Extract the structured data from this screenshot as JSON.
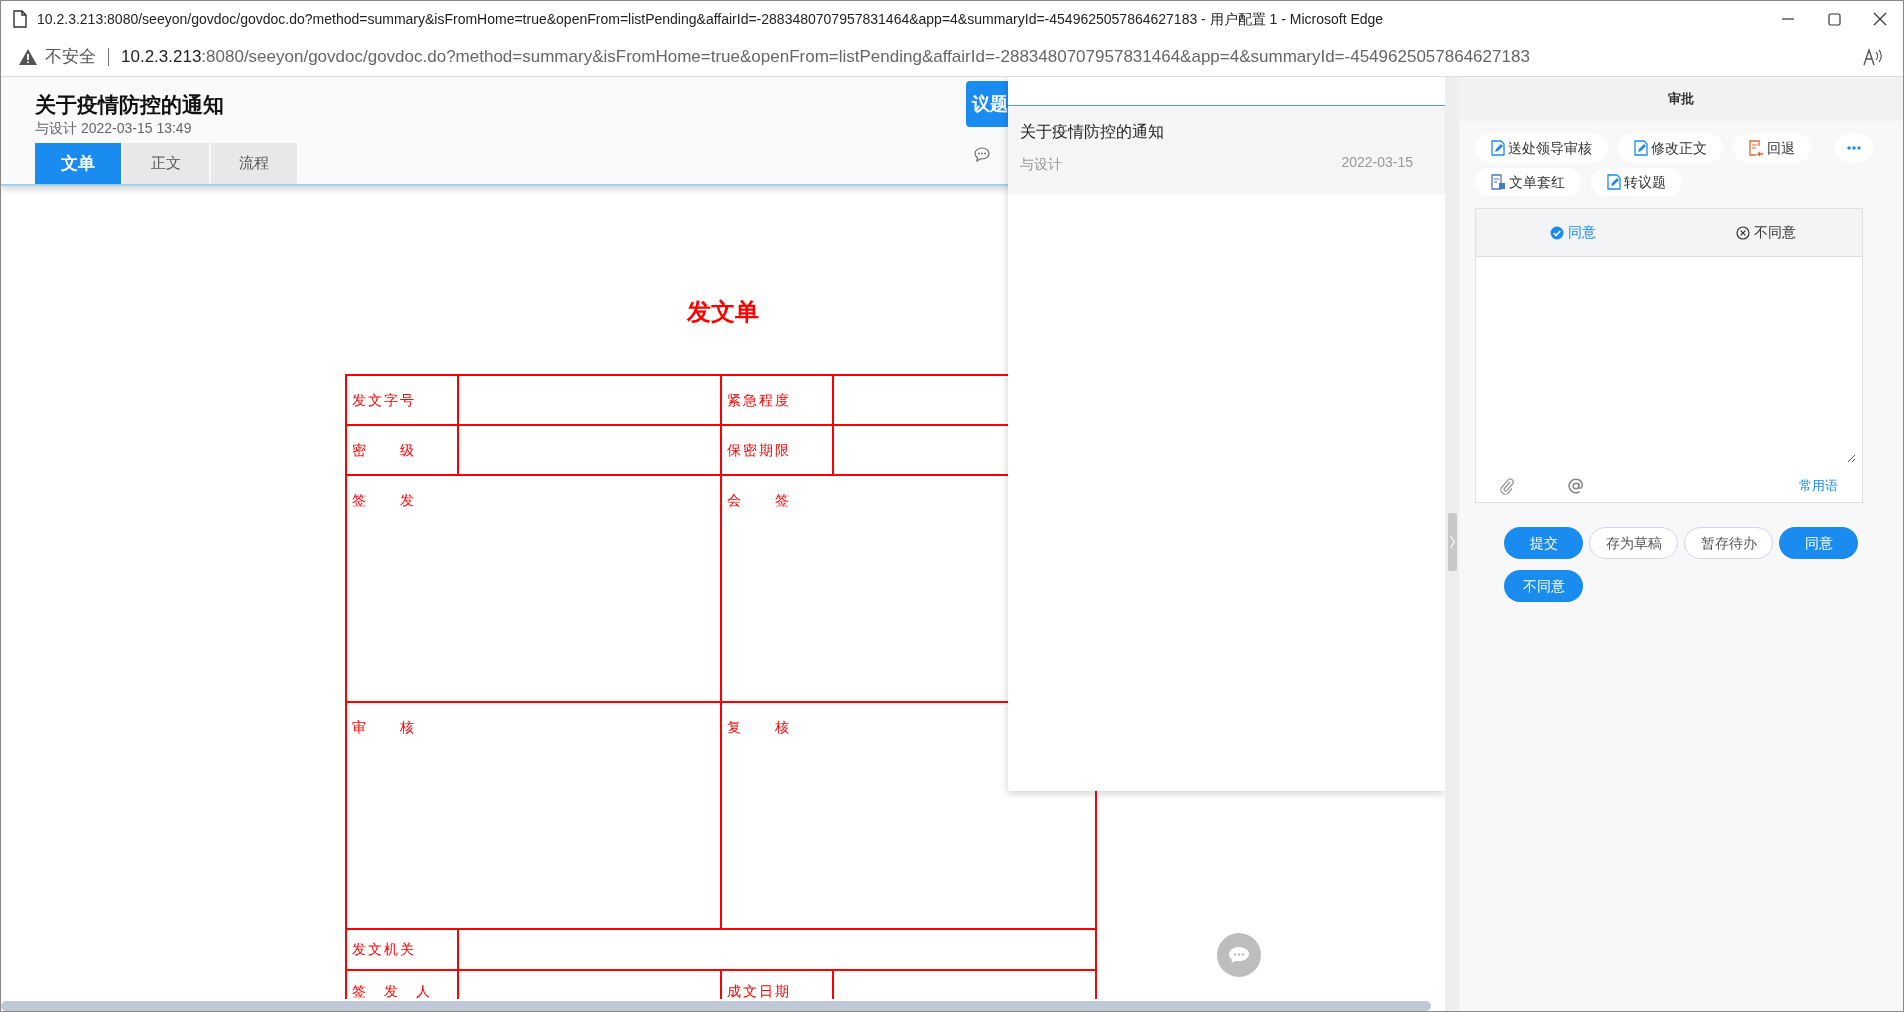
{
  "browser": {
    "title": "10.2.3.213:8080/seeyon/govdoc/govdoc.do?method=summary&isFromHome=true&openFrom=listPending&affairId=-2883480707957831464&app=4&summaryId=-4549625057864627183 - 用户配置 1 - Microsoft Edge",
    "security_label": "不安全",
    "url_host": "10.2.3.213",
    "url_rest": ":8080/seeyon/govdoc/govdoc.do?method=summary&isFromHome=true&openFrom=listPending&affairId=-2883480707957831464&app=4&summaryId=-4549625057864627183"
  },
  "document": {
    "title": "关于疫情防控的通知",
    "meta": "与设计 2022-03-15 13:49",
    "topic_button": "议题",
    "tabs": [
      {
        "label": "文单",
        "selected": true
      },
      {
        "label": "正文",
        "selected": false
      },
      {
        "label": "流程",
        "selected": false
      }
    ]
  },
  "form": {
    "title": "发文单",
    "rows": [
      {
        "kind": "short",
        "cells": [
          {
            "kind": "label",
            "text": "发文字号"
          },
          {
            "kind": "value"
          },
          {
            "kind": "label",
            "text": "紧急程度"
          },
          {
            "kind": "value"
          }
        ]
      },
      {
        "kind": "short",
        "cells": [
          {
            "kind": "label",
            "text": "密　　级"
          },
          {
            "kind": "value"
          },
          {
            "kind": "label",
            "text": "保密期限"
          },
          {
            "kind": "value"
          }
        ]
      },
      {
        "kind": "tall",
        "cells": [
          {
            "kind": "area",
            "text": "签　　发"
          },
          {
            "kind": "area",
            "text": "会　　签"
          }
        ]
      },
      {
        "kind": "tall",
        "cells": [
          {
            "kind": "area",
            "text": "审　　核"
          },
          {
            "kind": "area",
            "text": "复　　核"
          }
        ]
      },
      {
        "kind": "line",
        "cells": [
          {
            "kind": "label",
            "text": "发文机关"
          },
          {
            "kind": "wide"
          }
        ]
      },
      {
        "kind": "cut",
        "cells": [
          {
            "kind": "label",
            "text": "签　发　人"
          },
          {
            "kind": "value"
          },
          {
            "kind": "label",
            "text": "成文日期"
          },
          {
            "kind": "value"
          }
        ]
      }
    ]
  },
  "popup": {
    "title": "关于疫情防控的通知",
    "author": "与设计",
    "date": "2022-03-15"
  },
  "approval": {
    "title": "审批",
    "actions": [
      {
        "label": "送处领导审核",
        "kind": "edit"
      },
      {
        "label": "修改正文",
        "kind": "edit"
      },
      {
        "label": "回退",
        "kind": "return"
      },
      {
        "label": "文单套红",
        "kind": "stamp"
      },
      {
        "label": "转议题",
        "kind": "edit"
      }
    ],
    "opinion_tabs": [
      {
        "label": "同意",
        "kind": "agree",
        "selected": true
      },
      {
        "label": "不同意",
        "kind": "disagree",
        "selected": false
      }
    ],
    "phrases_link": "常用语",
    "buttons": [
      {
        "label": "提交",
        "primary": true
      },
      {
        "label": "存为草稿",
        "primary": false
      },
      {
        "label": "暂存待办",
        "primary": false
      },
      {
        "label": "同意",
        "primary": true
      },
      {
        "label": "不同意",
        "primary": true
      }
    ]
  }
}
